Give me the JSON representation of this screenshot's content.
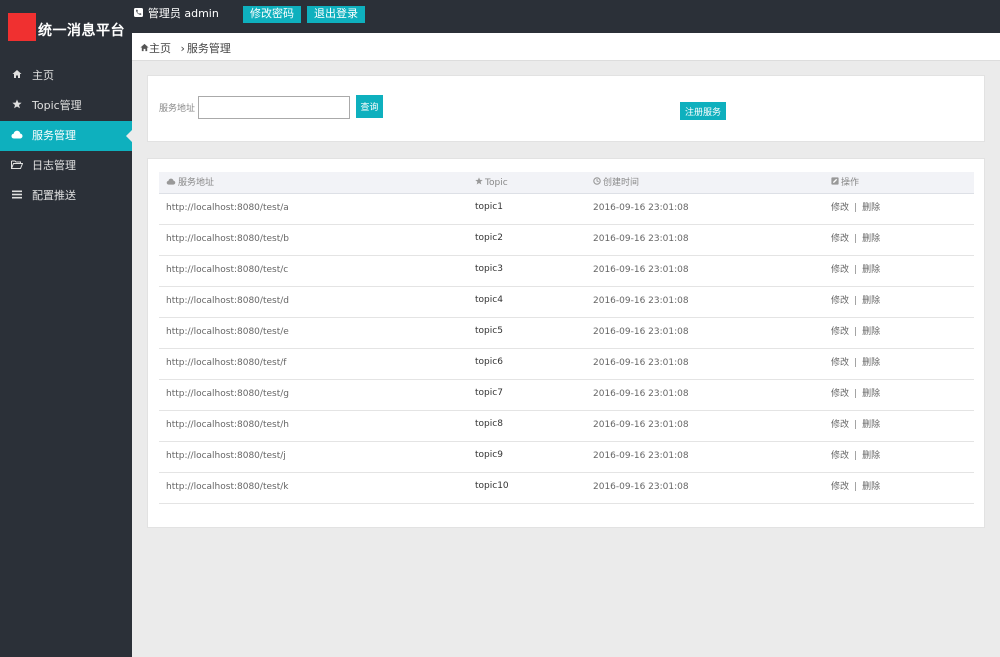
{
  "app": {
    "title": "统一消息平台"
  },
  "header": {
    "admin_label": "管理员 admin",
    "change_password": "修改密码",
    "logout": "退出登录"
  },
  "breadcrumb": {
    "home": "主页",
    "current": "服务管理"
  },
  "sidebar": {
    "items": [
      {
        "label": "主页",
        "icon": "home-icon"
      },
      {
        "label": "Topic管理",
        "icon": "star-icon"
      },
      {
        "label": "服务管理",
        "icon": "cloud-icon",
        "active": true
      },
      {
        "label": "日志管理",
        "icon": "folder-icon"
      },
      {
        "label": "配置推送",
        "icon": "menu-icon"
      }
    ]
  },
  "search": {
    "label": "服务地址",
    "value": "",
    "placeholder": "",
    "query_button": "查询",
    "register_button": "注册服务"
  },
  "table": {
    "headers": [
      "服务地址",
      "Topic",
      "创建时间",
      "操作"
    ],
    "rows": [
      {
        "url": "http://localhost:8080/test/a",
        "topic": "topic1",
        "created": "2016-09-16 23:01:08"
      },
      {
        "url": "http://localhost:8080/test/b",
        "topic": "topic2",
        "created": "2016-09-16 23:01:08"
      },
      {
        "url": "http://localhost:8080/test/c",
        "topic": "topic3",
        "created": "2016-09-16 23:01:08"
      },
      {
        "url": "http://localhost:8080/test/d",
        "topic": "topic4",
        "created": "2016-09-16 23:01:08"
      },
      {
        "url": "http://localhost:8080/test/e",
        "topic": "topic5",
        "created": "2016-09-16 23:01:08"
      },
      {
        "url": "http://localhost:8080/test/f",
        "topic": "topic6",
        "created": "2016-09-16 23:01:08"
      },
      {
        "url": "http://localhost:8080/test/g",
        "topic": "topic7",
        "created": "2016-09-16 23:01:08"
      },
      {
        "url": "http://localhost:8080/test/h",
        "topic": "topic8",
        "created": "2016-09-16 23:01:08"
      },
      {
        "url": "http://localhost:8080/test/j",
        "topic": "topic9",
        "created": "2016-09-16 23:01:08"
      },
      {
        "url": "http://localhost:8080/test/k",
        "topic": "topic10",
        "created": "2016-09-16 23:01:08"
      }
    ],
    "actions": {
      "edit": "修改",
      "separator": "|",
      "delete": "删除"
    }
  },
  "colors": {
    "sidebar_bg": "#2b3038",
    "accent": "#0eb0be",
    "logo": "#f03030"
  }
}
